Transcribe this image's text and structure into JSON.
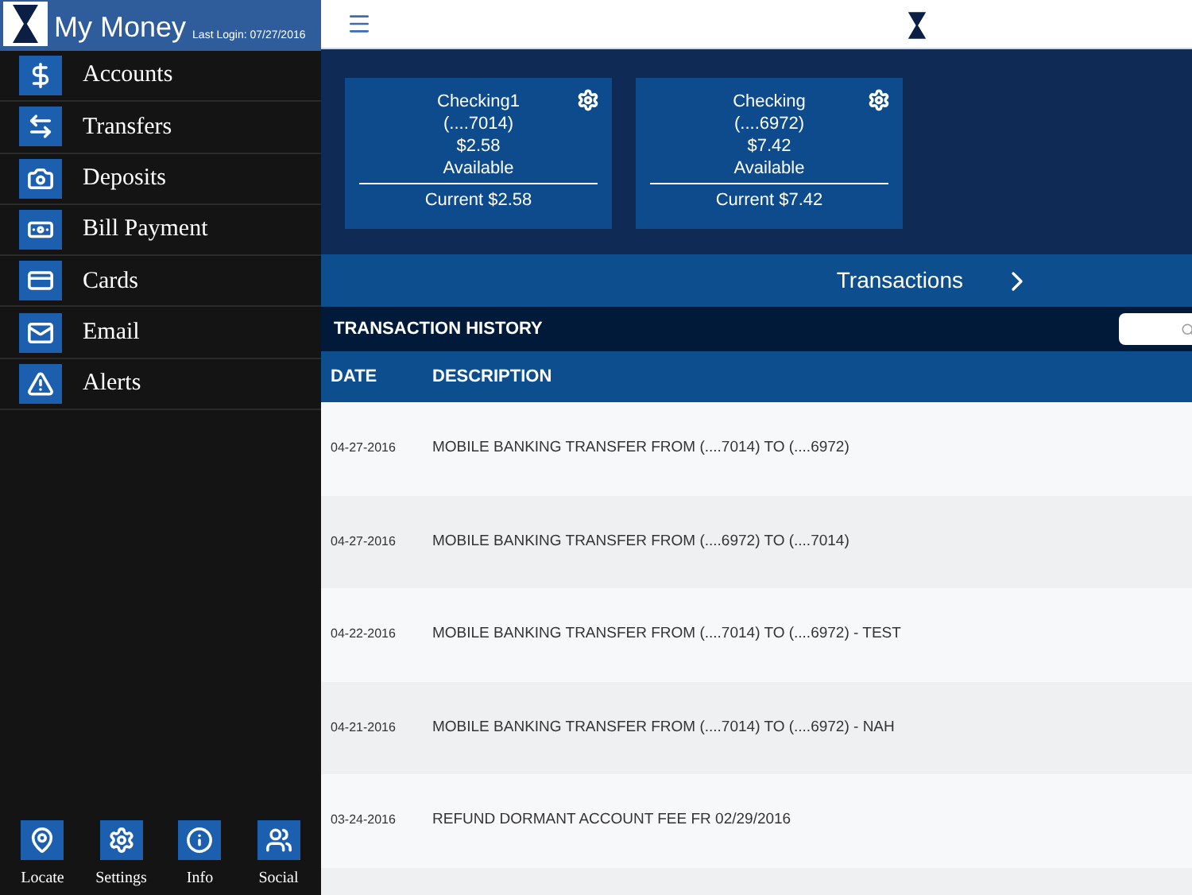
{
  "sidebar": {
    "title": "My Money",
    "last_login": "Last Login: 07/27/2016",
    "items": [
      {
        "label": "Accounts",
        "kind": "moneybag"
      },
      {
        "label": "Transfers",
        "kind": "transfer"
      },
      {
        "label": "Deposits",
        "kind": "camera"
      },
      {
        "label": "Bill Payment",
        "kind": "bill"
      },
      {
        "label": "Cards",
        "kind": "card"
      },
      {
        "label": "Email",
        "kind": "mail"
      },
      {
        "label": "Alerts",
        "kind": "alert"
      }
    ],
    "bottom": [
      {
        "label": "Locate",
        "kind": "pin"
      },
      {
        "label": "Settings",
        "kind": "gear"
      },
      {
        "label": "Info",
        "kind": "info"
      },
      {
        "label": "Social",
        "kind": "people"
      }
    ]
  },
  "accounts": [
    {
      "name": "Checking1",
      "number": "(....7014)",
      "balance": "$2.58",
      "balance_label": "Available",
      "current": "Current $2.58"
    },
    {
      "name": "Checking",
      "number": "(....6972)",
      "balance": "$7.42",
      "balance_label": "Available",
      "current": "Current $7.42"
    }
  ],
  "transactions_link": "Transactions",
  "history": {
    "title": "TRANSACTION HISTORY",
    "columns": [
      "DATE",
      "DESCRIPTION"
    ],
    "rows": [
      {
        "date": "04-27-2016",
        "description": "MOBILE BANKING TRANSFER FROM (....7014) TO (....6972)"
      },
      {
        "date": "04-27-2016",
        "description": "MOBILE BANKING TRANSFER FROM (....6972) TO (....7014)"
      },
      {
        "date": "04-22-2016",
        "description": "MOBILE BANKING TRANSFER FROM (....7014) TO (....6972) - TEST"
      },
      {
        "date": "04-21-2016",
        "description": "MOBILE BANKING TRANSFER FROM (....7014) TO (....6972) - NAH"
      },
      {
        "date": "03-24-2016",
        "description": "REFUND DORMANT ACCOUNT FEE FR 02/29/2016"
      }
    ]
  }
}
